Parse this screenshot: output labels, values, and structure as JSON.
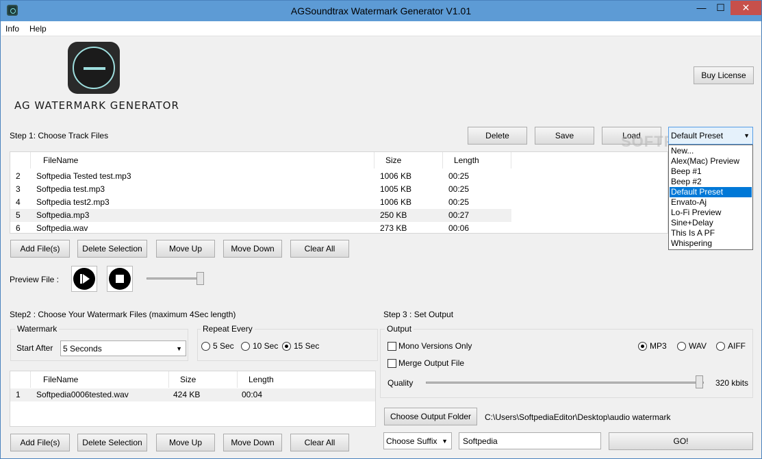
{
  "window": {
    "title": "AGSoundtrax Watermark Generator V1.01",
    "min_glyph": "—",
    "max_glyph": "☐",
    "close_glyph": "✕"
  },
  "menu": {
    "info": "Info",
    "help": "Help"
  },
  "logo": {
    "text": "AG WATERMARK GENERATOR"
  },
  "buy_license": "Buy License",
  "step1": {
    "label": "Step 1: Choose Track Files",
    "delete": "Delete",
    "save": "Save",
    "load": "Load",
    "preset_selected": "Default Preset",
    "preset_options": [
      "New...",
      "Alex(Mac) Preview",
      "Beep #1",
      "Beep #2",
      "Default Preset",
      "Envato-Aj",
      "Lo-Fi Preview",
      "Sine+Delay",
      "This Is A PF",
      "Whispering"
    ],
    "columns": {
      "filename": "FileName",
      "size": "Size",
      "length": "Length"
    },
    "rows": [
      {
        "num": "2",
        "name": "Softpedia Tested test.mp3",
        "size": "1006 KB",
        "length": "00:25"
      },
      {
        "num": "3",
        "name": "Softpedia test.mp3",
        "size": "1005 KB",
        "length": "00:25"
      },
      {
        "num": "4",
        "name": "Softpedia test2.mp3",
        "size": "1006 KB",
        "length": "00:25"
      },
      {
        "num": "5",
        "name": "Softpedia.mp3",
        "size": "250 KB",
        "length": "00:27"
      },
      {
        "num": "6",
        "name": "Softpedia.wav",
        "size": "273 KB",
        "length": "00:06"
      }
    ],
    "add_files": "Add File(s)",
    "delete_selection": "Delete Selection",
    "move_up": "Move Up",
    "move_down": "Move Down",
    "clear_all": "Clear All",
    "preview_label": "Preview File :"
  },
  "step2": {
    "label": "Step2 : Choose Your Watermark Files (maximum 4Sec length)",
    "watermark_group": "Watermark",
    "start_after_label": "Start After",
    "start_after_value": "5 Seconds",
    "repeat_group": "Repeat Every",
    "repeat_options": [
      "5 Sec",
      "10 Sec",
      "15 Sec"
    ],
    "repeat_selected": "15 Sec",
    "columns": {
      "filename": "FileName",
      "size": "Size",
      "length": "Length"
    },
    "rows": [
      {
        "num": "1",
        "name": "Softpedia0006tested.wav",
        "size": "424 KB",
        "length": "00:04"
      }
    ],
    "add_files": "Add File(s)",
    "delete_selection": "Delete Selection",
    "move_up": "Move Up",
    "move_down": "Move Down",
    "clear_all": "Clear All"
  },
  "step3": {
    "label": "Step 3 : Set Output",
    "output_group": "Output",
    "mono_label": "Mono Versions Only",
    "merge_label": "Merge Output File",
    "formats": [
      "MP3",
      "WAV",
      "AIFF"
    ],
    "format_selected": "MP3",
    "quality_label": "Quality",
    "quality_value": "320 kbits",
    "choose_output_folder": "Choose Output Folder",
    "output_path": "C:\\Users\\SoftpediaEditor\\Desktop\\audio watermark",
    "choose_suffix": "Choose Suffix",
    "suffix_value": "Softpedia",
    "go": "GO!"
  },
  "overlay_watermark": "SOFTPEDIA"
}
